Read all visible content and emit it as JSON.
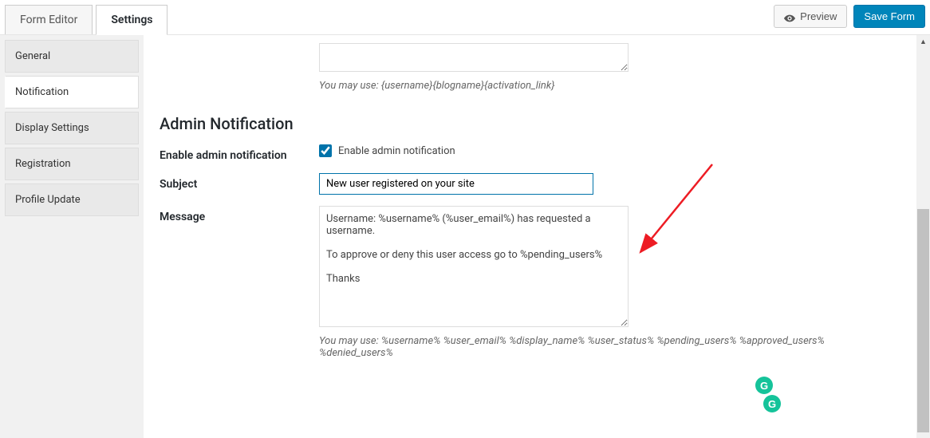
{
  "topTabs": {
    "formEditor": "Form Editor",
    "settings": "Settings"
  },
  "actions": {
    "preview": "Preview",
    "save": "Save Form"
  },
  "sidebar": {
    "items": [
      "General",
      "Notification",
      "Display Settings",
      "Registration",
      "Profile Update"
    ]
  },
  "topHelper": "You may use: {username}{blogname}{activation_link}",
  "sectionTitle": "Admin Notification",
  "enableRow": {
    "label": "Enable admin notification",
    "checkboxLabel": "Enable admin notification"
  },
  "subjectRow": {
    "label": "Subject",
    "value": "New user registered on your site"
  },
  "messageRow": {
    "label": "Message",
    "value": "Username: %username% (%user_email%) has requested a username.\n\nTo approve or deny this user access go to %pending_users%\n\nThanks",
    "helper": "You may use: %username% %user_email% %display_name% %user_status% %pending_users% %approved_users% %denied_users%"
  }
}
